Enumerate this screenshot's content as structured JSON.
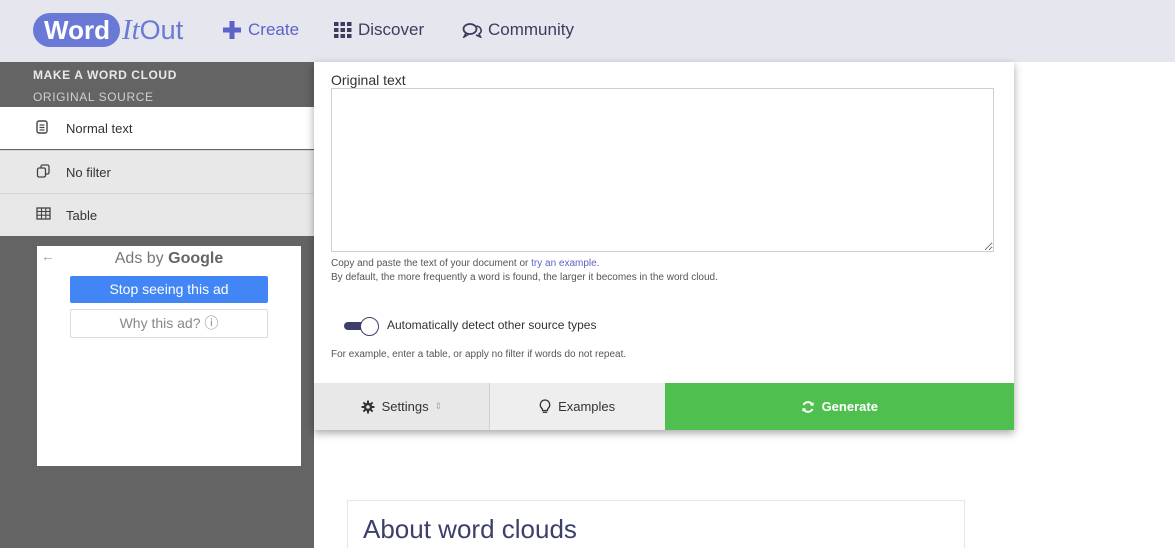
{
  "header": {
    "logo": {
      "word": "Word",
      "it": "It",
      "out": "Out"
    },
    "nav": [
      {
        "label": "Create",
        "icon": "plus-icon",
        "color": "#5b63c8"
      },
      {
        "label": "Discover",
        "icon": "grid-icon"
      },
      {
        "label": "Community",
        "icon": "chat-bubbles-icon"
      }
    ]
  },
  "sidebar": {
    "heading": "MAKE A WORD CLOUD",
    "subheading": "ORIGINAL SOURCE",
    "items": [
      {
        "label": "Normal text",
        "icon": "document-icon",
        "selected": true
      },
      {
        "label": "No filter",
        "icon": "copy-icon",
        "selected": false
      },
      {
        "label": "Table",
        "icon": "table-icon",
        "selected": false
      }
    ]
  },
  "ad": {
    "title_prefix": "Ads by",
    "title_brand": "Google",
    "stop_label": "Stop seeing this ad",
    "why_label": "Why this ad? ⓘ"
  },
  "form": {
    "label": "Original text",
    "textarea_value": "",
    "help_line1_prefix": "Copy and paste the text of your document or ",
    "help_line1_link": "try an example",
    "help_line1_suffix": ".",
    "help_line2": "By default, the more frequently a word is found, the larger it becomes in the word cloud.",
    "toggle_label": "Automatically detect other source types",
    "toggle_on": true,
    "help_line3": "For example, enter a table, or apply no filter if words do not repeat."
  },
  "tabs": {
    "settings": "Settings",
    "examples": "Examples",
    "generate": "Generate"
  },
  "about": {
    "title": "About word clouds"
  },
  "colors": {
    "accent": "#5b63c8",
    "generate": "#4fc04f",
    "sidebar": "#646464",
    "topbar": "#e6e6ef"
  }
}
